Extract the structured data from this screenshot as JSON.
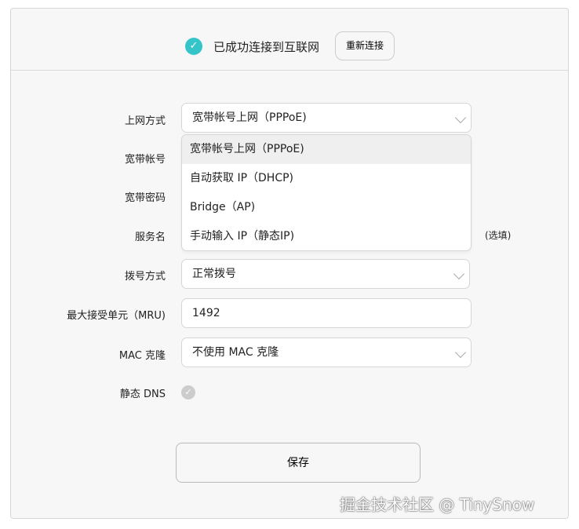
{
  "header": {
    "status": "已成功连接到互联网",
    "reconnect": "重新连接"
  },
  "form": {
    "wan_mode": {
      "label": "上网方式",
      "value": "宽带帐号上网（PPPoE)",
      "options": [
        "宽带帐号上网（PPPoE)",
        "自动获取 IP（DHCP)",
        "Bridge（AP)",
        "手动输入 IP（静态IP)"
      ]
    },
    "account": {
      "label": "宽带帐号"
    },
    "password": {
      "label": "宽带密码"
    },
    "service": {
      "label": "服务名",
      "hint": "(选填)"
    },
    "dial": {
      "label": "拨号方式",
      "value": "正常拨号"
    },
    "mru": {
      "label": "最大接受单元（MRU)",
      "value": "1492"
    },
    "mac": {
      "label": "MAC 克隆",
      "value": "不使用 MAC 克隆"
    },
    "dns": {
      "label": "静态 DNS"
    }
  },
  "save": "保存",
  "watermark": "掘金技术社区 @ TinySnow"
}
